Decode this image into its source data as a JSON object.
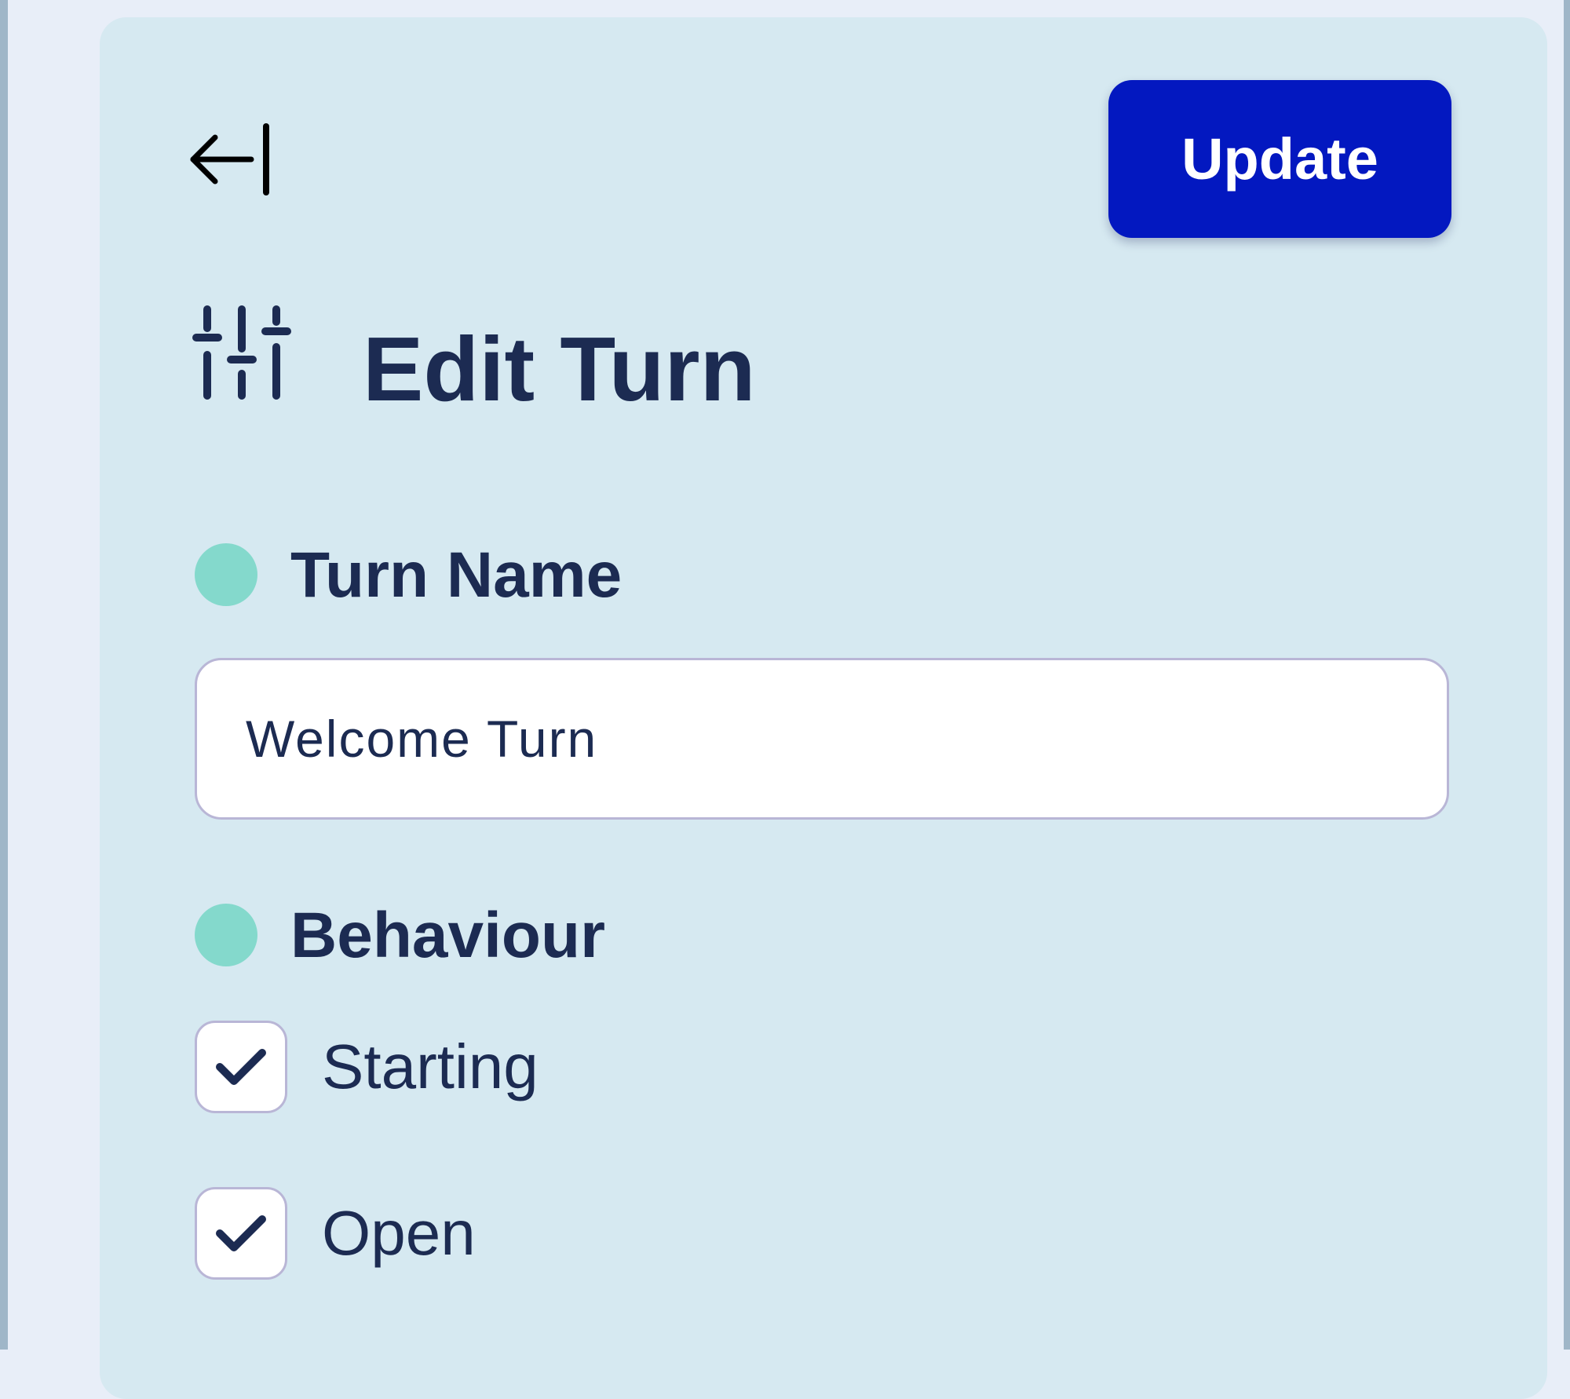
{
  "header": {
    "back_icon": "arrow-left-to-line-icon",
    "update_label": "Update"
  },
  "title": {
    "icon": "sliders-icon",
    "text": "Edit Turn"
  },
  "turn_name": {
    "label": "Turn Name",
    "value": "Welcome Turn"
  },
  "behaviour": {
    "label": "Behaviour",
    "options": [
      {
        "label": "Starting",
        "checked": true
      },
      {
        "label": "Open",
        "checked": true
      }
    ]
  },
  "colors": {
    "accent": "#0318c0",
    "panel": "#d6e9f1",
    "text": "#1c2b52",
    "dot": "#84d9cc"
  }
}
